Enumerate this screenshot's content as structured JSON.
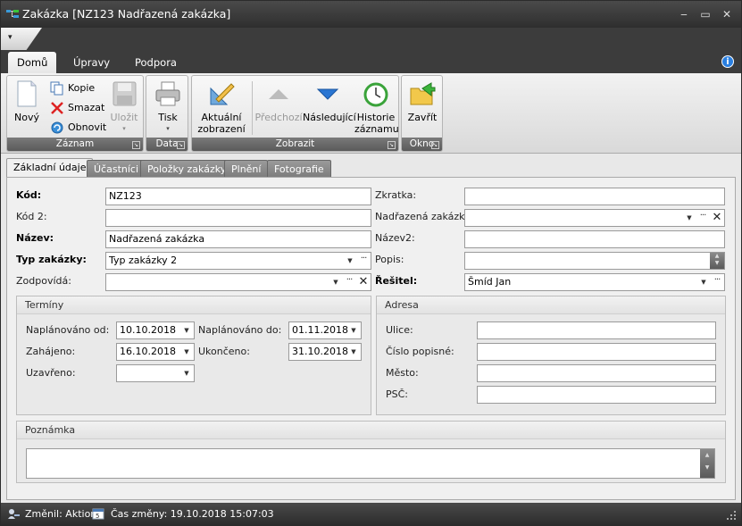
{
  "window": {
    "title": "Zakázka [NZ123 Nadřazená zakázka]",
    "min": "‒",
    "max": "▭",
    "close": "✕"
  },
  "qat": {
    "arrow": "▾"
  },
  "ribbon_tabs": [
    {
      "label": "Domů"
    },
    {
      "label": "Úpravy"
    },
    {
      "label": "Podpora"
    }
  ],
  "info_icon": "i",
  "ribbon": {
    "groups": {
      "zaznam": "Záznam",
      "data": "Data",
      "zobrazit": "Zobrazit",
      "okno": "Okno"
    },
    "novy": "Nový",
    "kopie": "Kopie",
    "smazat": "Smazat",
    "obnovit": "Obnovit",
    "ulozit": "Uložit",
    "tisk": "Tisk",
    "aktualni_1": "Aktuální",
    "aktualni_2": "zobrazení ▾",
    "predchozi": "Předchozí",
    "nasledujici": "Následující",
    "historie_1": "Historie",
    "historie_2": "záznamu",
    "zavrit": "Zavřít",
    "drop_arrow": "▾"
  },
  "doc_tabs": [
    {
      "label": "Základní údaje"
    },
    {
      "label": "Účastníci"
    },
    {
      "label": "Položky zakázky"
    },
    {
      "label": "Plnění"
    },
    {
      "label": "Fotografie"
    }
  ],
  "form": {
    "kod": {
      "label": "Kód:",
      "value": "NZ123"
    },
    "kod2": {
      "label": "Kód 2:",
      "value": ""
    },
    "nazev": {
      "label": "Název:",
      "value": "Nadřazená zakázka"
    },
    "typ": {
      "label": "Typ zakázky:",
      "value": "Typ zakázky 2"
    },
    "zodpovida": {
      "label": "Zodpovídá:",
      "value": ""
    },
    "zkratka": {
      "label": "Zkratka:",
      "value": ""
    },
    "nadrazena": {
      "label": "Nadřazená zakázka:",
      "value": ""
    },
    "nazev2": {
      "label": "Název2:",
      "value": ""
    },
    "popis": {
      "label": "Popis:",
      "value": ""
    },
    "resitel": {
      "label": "Řešitel:",
      "value": "Šmíd Jan"
    }
  },
  "terminy": {
    "title": "Termíny",
    "naplanovano_od": {
      "label": "Naplánováno od:",
      "value": "10.10.2018"
    },
    "naplanovano_do": {
      "label": "Naplánováno do:",
      "value": "01.11.2018"
    },
    "zahajeno": {
      "label": "Zahájeno:",
      "value": "16.10.2018"
    },
    "ukonceno": {
      "label": "Ukončeno:",
      "value": "31.10.2018"
    },
    "uzavreno": {
      "label": "Uzavřeno:",
      "value": ""
    }
  },
  "adresa": {
    "title": "Adresa",
    "ulice": {
      "label": "Ulice:",
      "value": ""
    },
    "cislo": {
      "label": "Číslo popisné:",
      "value": ""
    },
    "mesto": {
      "label": "Město:",
      "value": ""
    },
    "psc": {
      "label": "PSČ:",
      "value": ""
    }
  },
  "poznamka": {
    "title": "Poznámka",
    "value": ""
  },
  "status": {
    "zmenil": "Změnil: Aktion",
    "cas": "Čas změny: 19.10.2018 15:07:03"
  },
  "glyphs": {
    "dd": "▼",
    "el": "···",
    "x": "✕",
    "up": "▲",
    "down": "▼"
  }
}
